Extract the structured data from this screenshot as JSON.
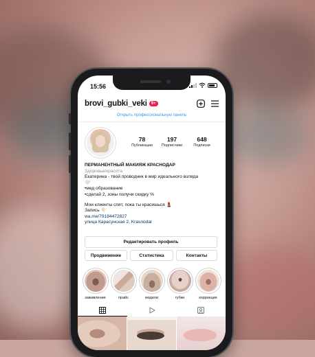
{
  "status": {
    "time": "15:56"
  },
  "profile": {
    "username": "brovi_gubki_veki",
    "notif_badge": "9+",
    "pro_panel_link": "Открыть профессиональную панель"
  },
  "stats": [
    {
      "value": "78",
      "label": "Публикации"
    },
    {
      "value": "197",
      "label": "Подписчики"
    },
    {
      "value": "648",
      "label": "Подписки"
    }
  ],
  "bio": {
    "title": "ПЕРМАНЕНТНЫЙ МАКИЯЖ КРАСНОДАР",
    "category": "Здоровье/красота",
    "line1": "Екатерина - твой проводник в мир идеального взляда",
    "heart": "🤍",
    "line2": "•мед образование",
    "line3": "•сделай 2, зоны получи скидку %",
    "line4": "Мои клиенты спят, пока ты красишься 💄",
    "line5": "Запись 👇🏻",
    "link": "wa.me/79184472827",
    "address": "улица Карасунская 2, Krasnodar"
  },
  "buttons": {
    "edit_profile": "Редактировать профиль",
    "promotion": "Продвижение",
    "statistics": "Статистика",
    "contacts": "Контакты"
  },
  "highlights": [
    {
      "label": "заживление",
      "color": "#c39a8e"
    },
    {
      "label": "прайс",
      "color": "#d9c7bd"
    },
    {
      "label": "модели",
      "color": "#c8b09f"
    },
    {
      "label": "губки",
      "color": "#e7d0c8"
    },
    {
      "label": "коррекция",
      "color": "#dbb3a8"
    }
  ],
  "tabs": [
    {
      "icon": "grid-icon"
    },
    {
      "icon": "reels-play-icon"
    },
    {
      "icon": "tagged-person-icon"
    }
  ],
  "colors": {
    "link_blue": "#3897f0",
    "badge_red": "#ed1c4f"
  }
}
